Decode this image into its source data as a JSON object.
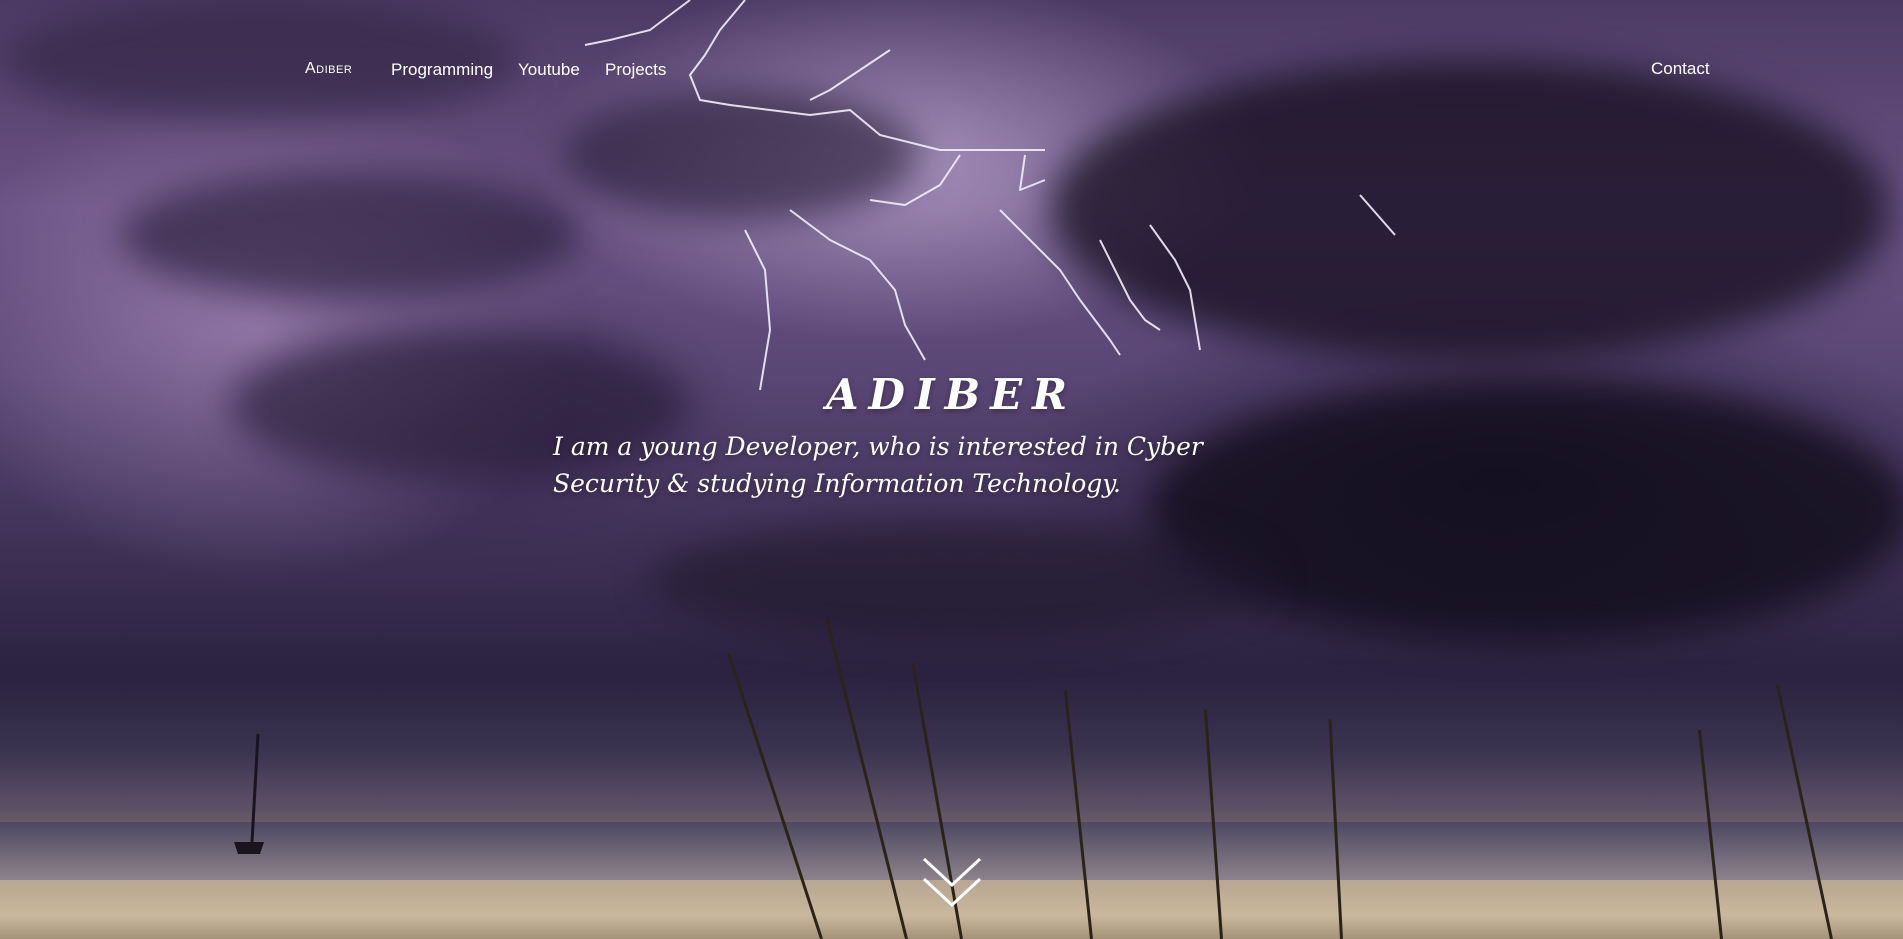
{
  "nav": {
    "logo": "Adiber",
    "links": [
      {
        "label": "Programming"
      },
      {
        "label": "Youtube"
      },
      {
        "label": "Projects"
      }
    ],
    "contact": "Contact"
  },
  "hero": {
    "title": "ADIBER",
    "subtitle": "I am a young Developer, who is interested in Cyber Security & studying Information Technology."
  },
  "icons": {
    "scroll_down": "double-chevron-down-icon"
  },
  "colors": {
    "text": "#ffffff",
    "sky": "#5a4675",
    "night": "#1a1428"
  }
}
